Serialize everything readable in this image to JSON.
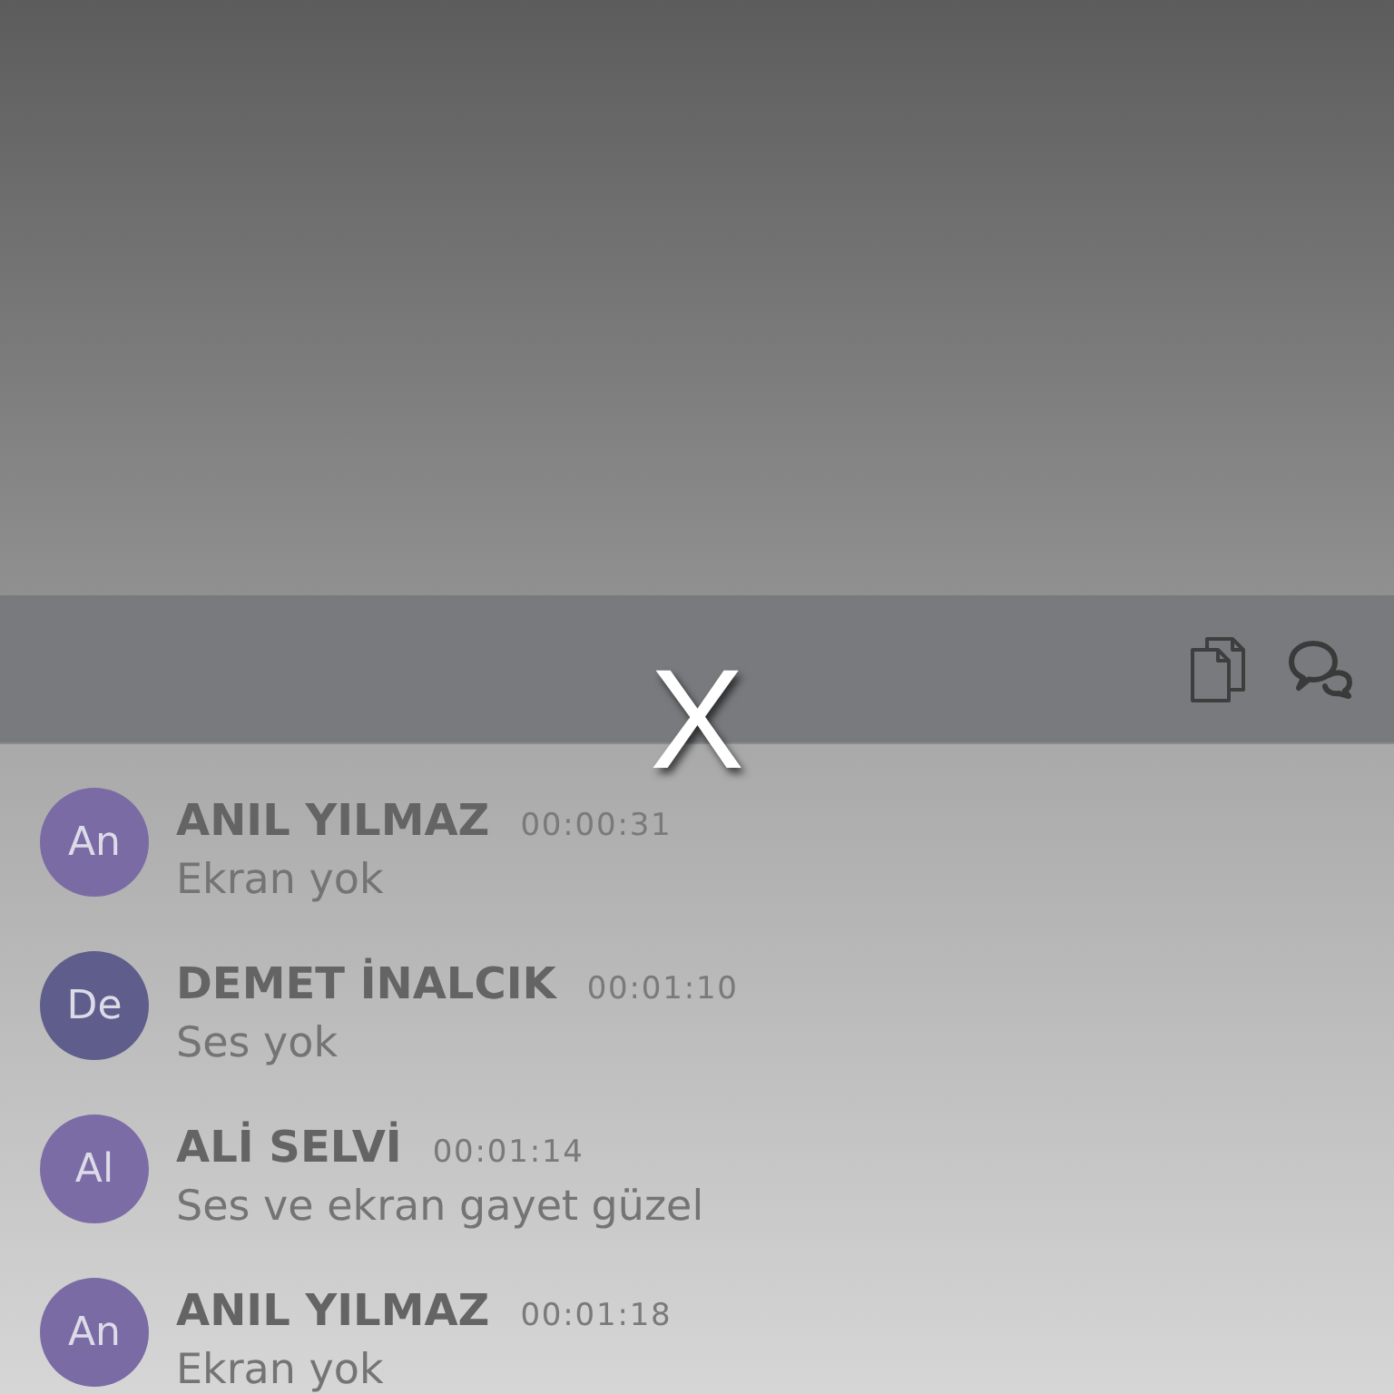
{
  "close_button": {
    "label": "X"
  },
  "messages": [
    {
      "initials": "An",
      "color": "#7b6ba5",
      "sender": "ANIL YILMAZ",
      "time": "00:00:31",
      "text": "Ekran yok"
    },
    {
      "initials": "De",
      "color": "#5f5d8b",
      "sender": "DEMET İNALCIK",
      "time": "00:01:10",
      "text": "Ses yok"
    },
    {
      "initials": "Al",
      "color": "#7c6ca6",
      "sender": "ALİ SELVİ",
      "time": "00:01:14",
      "text": "Ses ve ekran gayet güzel"
    },
    {
      "initials": "An",
      "color": "#7b6ba5",
      "sender": "ANIL YILMAZ",
      "time": "00:01:18",
      "text": "Ekran yok"
    }
  ]
}
